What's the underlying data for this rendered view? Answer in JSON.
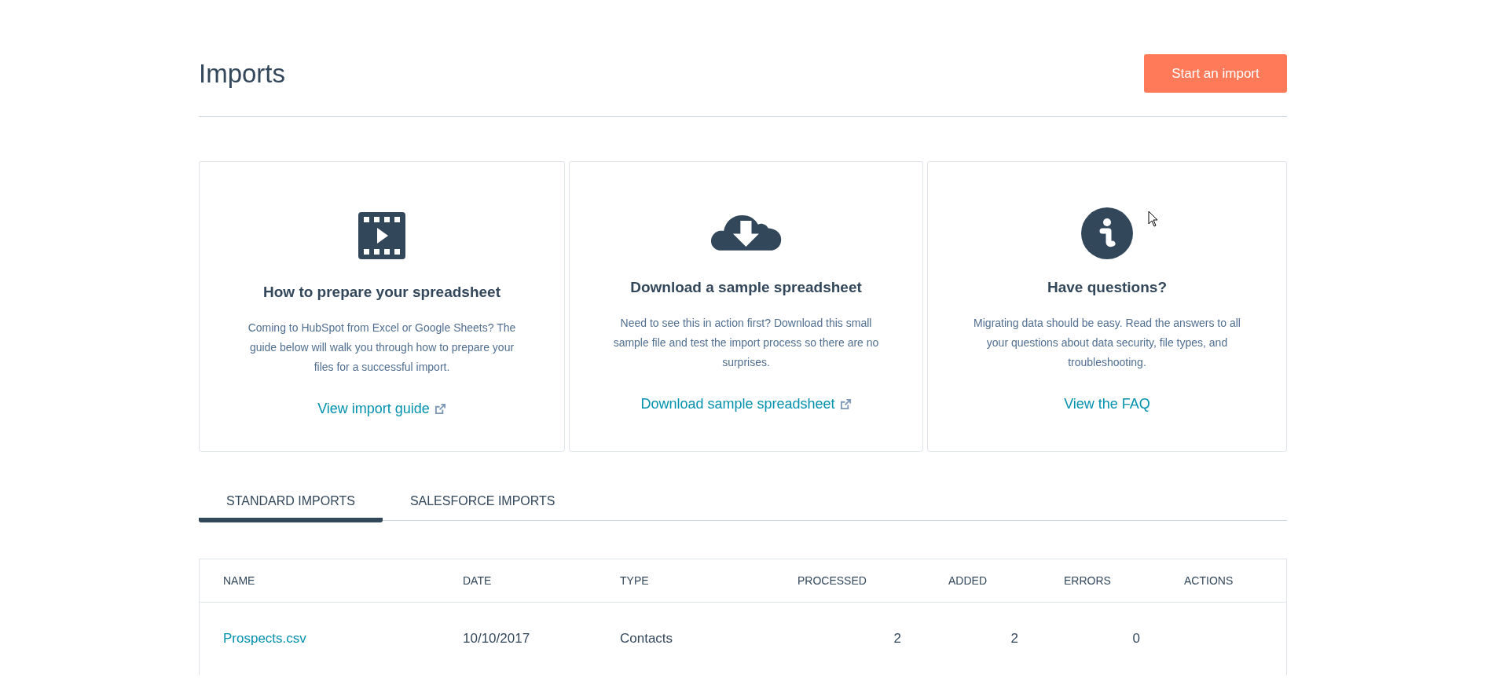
{
  "header": {
    "title": "Imports",
    "button": "Start an import"
  },
  "cards": [
    {
      "kind": "video",
      "title": "How to prepare your spreadsheet",
      "text": "Coming to HubSpot from Excel or Google Sheets? The guide below will walk you through how to prepare your files for a successful import.",
      "link": {
        "label": "View import guide",
        "external": true
      }
    },
    {
      "kind": "download",
      "title": "Download a sample spreadsheet",
      "text": "Need to see this in action first? Download this small sample file and test the import process so there are no surprises.",
      "link": {
        "label": "Download sample spreadsheet",
        "external": true
      }
    },
    {
      "kind": "info",
      "title": "Have questions?",
      "text": "Migrating data should be easy. Read the answers to all your questions about data security, file types, and troubleshooting.",
      "link": {
        "label": "View the FAQ",
        "external": false
      }
    }
  ],
  "tabs": [
    {
      "label": "STANDARD IMPORTS",
      "selected": true
    },
    {
      "label": "SALESFORCE IMPORTS",
      "selected": false
    }
  ],
  "table": {
    "columns": [
      "NAME",
      "DATE",
      "TYPE",
      "PROCESSED",
      "ADDED",
      "ERRORS",
      "ACTIONS"
    ],
    "rows": [
      {
        "name": "Prospects.csv",
        "date": "10/10/2017",
        "type": "Contacts",
        "processed": "2",
        "added": "2",
        "errors": "0"
      }
    ]
  }
}
